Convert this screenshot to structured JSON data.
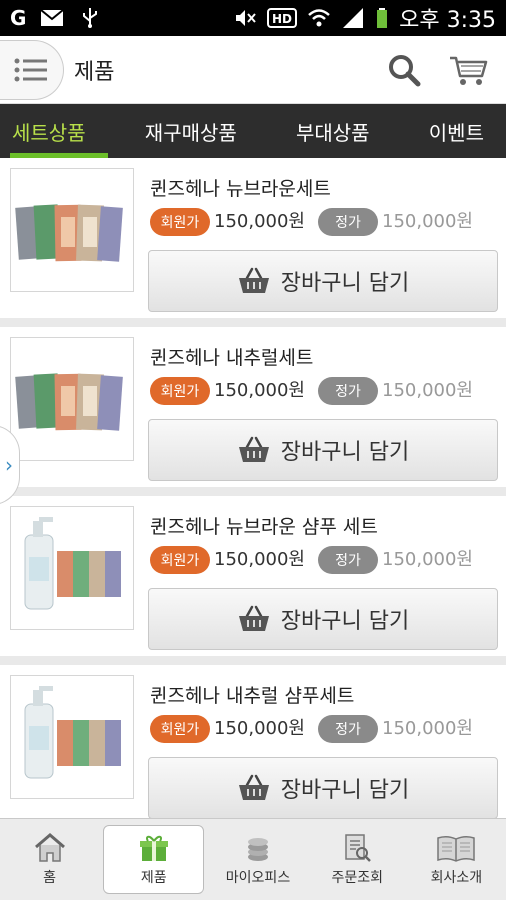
{
  "status_bar": {
    "carrier_icon": "G",
    "time": "오후 3:35"
  },
  "header": {
    "title": "제품",
    "search_icon": "search-icon",
    "cart_icon": "cart-icon",
    "menu_icon": "menu-icon"
  },
  "tabs": [
    {
      "label": "세트상품",
      "active": true
    },
    {
      "label": "재구매상품",
      "active": false
    },
    {
      "label": "부대상품",
      "active": false
    },
    {
      "label": "이벤트",
      "active": false
    }
  ],
  "products": [
    {
      "name": "퀸즈헤나 뉴브라운세트",
      "member_label": "회원가",
      "member_price": "150,000원",
      "regular_label": "정가",
      "regular_price": "150,000원",
      "cart_label": "장바구니 담기",
      "image": "sachets"
    },
    {
      "name": "퀸즈헤나 내추럴세트",
      "member_label": "회원가",
      "member_price": "150,000원",
      "regular_label": "정가",
      "regular_price": "150,000원",
      "cart_label": "장바구니 담기",
      "image": "sachets"
    },
    {
      "name": "퀸즈헤나 뉴브라운 샴푸 세트",
      "member_label": "회원가",
      "member_price": "150,000원",
      "regular_label": "정가",
      "regular_price": "150,000원",
      "cart_label": "장바구니 담기",
      "image": "shampoo"
    },
    {
      "name": "퀸즈헤나 내추럴 샴푸세트",
      "member_label": "회원가",
      "member_price": "150,000원",
      "regular_label": "정가",
      "regular_price": "150,000원",
      "cart_label": "장바구니 담기",
      "image": "shampoo"
    }
  ],
  "bottom_nav": [
    {
      "label": "홈",
      "icon": "home-icon",
      "active": false
    },
    {
      "label": "제품",
      "icon": "gift-icon",
      "active": true
    },
    {
      "label": "마이오피스",
      "icon": "coins-icon",
      "active": false
    },
    {
      "label": "주문조회",
      "icon": "order-search-icon",
      "active": false
    },
    {
      "label": "회사소개",
      "icon": "book-icon",
      "active": false
    }
  ],
  "colors": {
    "accent_green": "#6cbf2a",
    "member_badge": "#e0692a",
    "regular_badge": "#8a8a8a",
    "tab_bar": "#2d2d2d"
  }
}
